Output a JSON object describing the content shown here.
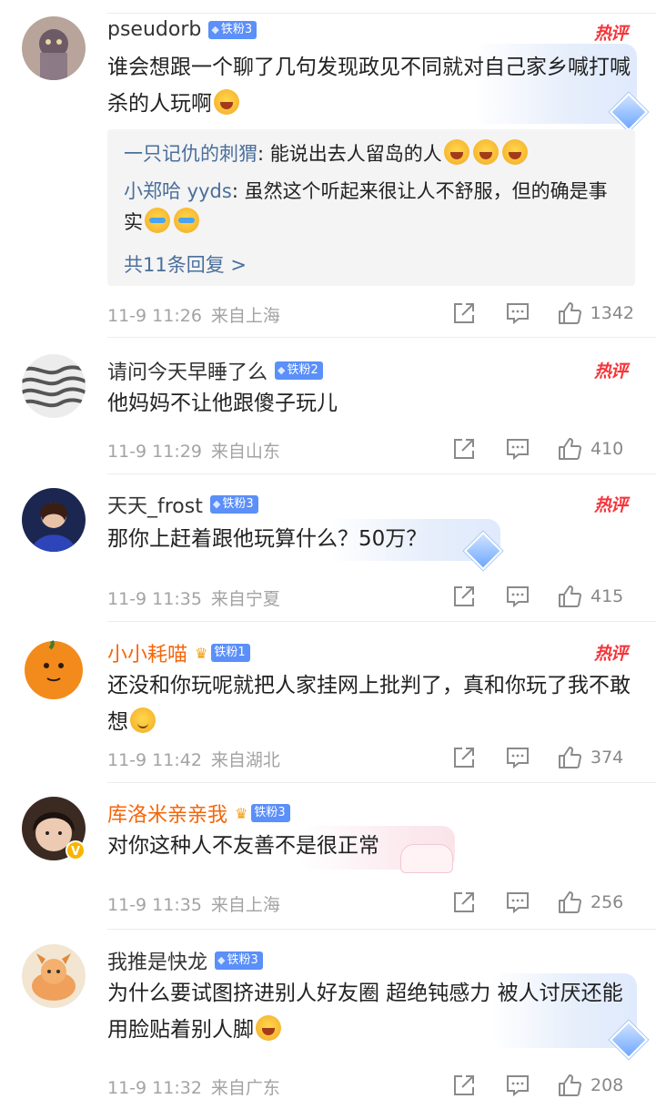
{
  "comments": [
    {
      "username": "pseudorb",
      "badge": "铁粉3",
      "hot": "热评",
      "text": "谁会想跟一个聊了几句发现政见不同就对自己家乡喊打喊杀的人玩啊",
      "time": "11-9 11:26",
      "location": "来自上海",
      "likes": "1342",
      "replies": [
        {
          "name": "一只记仇的刺猬",
          "text": "能说出去人留岛的人"
        },
        {
          "name": "小郑哈 yyds",
          "text": "虽然这个听起来很让人不舒服，但的确是事实"
        }
      ],
      "more_replies": "共11条回复 >"
    },
    {
      "username": "请问今天早睡了么",
      "badge": "铁粉2",
      "hot": "热评",
      "text": "他妈妈不让他跟傻子玩儿",
      "time": "11-9 11:29",
      "location": "来自山东",
      "likes": "410"
    },
    {
      "username": "天天_frost",
      "badge": "铁粉3",
      "hot": "热评",
      "text": "那你上赶着跟他玩算什么？50万？",
      "time": "11-9 11:35",
      "location": "来自宁夏",
      "likes": "415"
    },
    {
      "username": "小小耗喵",
      "badge": "铁粉1",
      "hot": "热评",
      "text": "还没和你玩呢就把人家挂网上批判了，真和你玩了我不敢想",
      "time": "11-9 11:42",
      "location": "来自湖北",
      "likes": "374"
    },
    {
      "username": "库洛米亲亲我",
      "badge": "铁粉3",
      "text": "对你这种人不友善不是很正常",
      "time": "11-9 11:35",
      "location": "来自上海",
      "likes": "256"
    },
    {
      "username": "我推是快龙",
      "badge": "铁粉3",
      "text": "为什么要试图挤进别人好友圈 超绝钝感力 被人讨厌还能用脸贴着别人脚",
      "time": "11-9 11:32",
      "location": "来自广东",
      "likes": "208"
    }
  ],
  "colors": {
    "link": "#4a6f9c",
    "hot": "#f4363b",
    "vip_name": "#f5660a",
    "badge": "#5b8ff9",
    "meta": "#a3a3a3"
  },
  "icons": [
    "share-icon",
    "comment-icon",
    "like-icon",
    "diamond-badge-icon",
    "crown-icon",
    "verified-icon"
  ]
}
